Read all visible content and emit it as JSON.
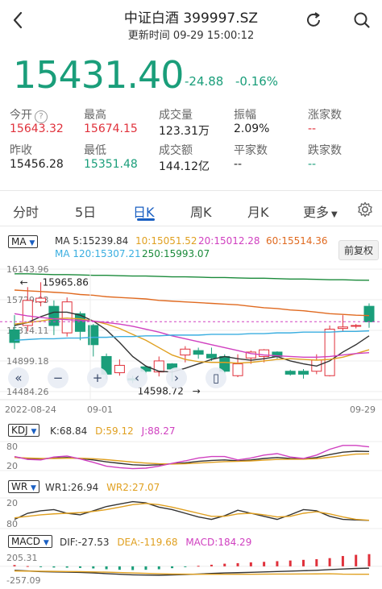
{
  "header": {
    "title": "中证白酒 399997.SZ",
    "update_label": "更新时间",
    "update_time": "09-29 15:00:12"
  },
  "quote": {
    "price": "15431.40",
    "change": "-24.88",
    "change_pct": "-0.16%"
  },
  "stats": [
    {
      "label": "今开",
      "value": "15643.32",
      "color": "red",
      "info_icon": true
    },
    {
      "label": "最高",
      "value": "15674.15",
      "color": "red"
    },
    {
      "label": "成交量",
      "value": "123.31万",
      "color": "normal"
    },
    {
      "label": "振幅",
      "value": "2.09%",
      "color": "normal"
    },
    {
      "label": "涨家数",
      "value": "--",
      "color": "red"
    },
    {
      "label": "昨收",
      "value": "15456.28",
      "color": "normal"
    },
    {
      "label": "最低",
      "value": "15351.48",
      "color": "green"
    },
    {
      "label": "成交额",
      "value": "144.12亿",
      "color": "normal"
    },
    {
      "label": "平家数",
      "value": "--",
      "color": "normal"
    },
    {
      "label": "跌家数",
      "value": "--",
      "color": "green"
    }
  ],
  "tabs": [
    "分时",
    "5日",
    "日K",
    "周K",
    "月K",
    "更多"
  ],
  "active_tab": "日K",
  "ma_legend": {
    "selector": "MA",
    "items": [
      {
        "text": "MA 5:15239.84",
        "color": "#333333"
      },
      {
        "text": "10:15051.52",
        "color": "#e0a020"
      },
      {
        "text": "20:15012.28",
        "color": "#d040c0"
      },
      {
        "text": "60:15514.36",
        "color": "#e06a20"
      },
      {
        "text": "MA 120:15307.21",
        "color": "#3aaee0"
      },
      {
        "text": "250:15993.07",
        "color": "#1a8a3a"
      }
    ],
    "fuquan_button": "前复权"
  },
  "main_axis": {
    "y_labels": [
      "16143.96",
      "15729.03",
      "15314.11",
      "14899.18",
      "14484.26"
    ],
    "x_labels": [
      "2022-08-24",
      "09-01",
      "09-29"
    ]
  },
  "main_annotations": {
    "high": "15965.86",
    "low": "14598.72"
  },
  "kdj": {
    "selector": "KDJ",
    "k": "K:68.84",
    "d": "D:59.12",
    "j": "J:88.27",
    "y_labels": [
      "80",
      "20"
    ]
  },
  "wr": {
    "selector": "WR",
    "wr1": "WR1:26.94",
    "wr2": "WR2:27.07",
    "y_labels": [
      "20",
      "80"
    ]
  },
  "macd": {
    "selector": "MACD",
    "dif": "DIF:-27.53",
    "dea": "DEA:-119.68",
    "macd": "MACD:184.29",
    "y_labels": [
      "205.31",
      "-257.09"
    ]
  },
  "colors": {
    "up": "#e0313b",
    "down": "#1a9e7a",
    "accent": "#1a5fc2"
  },
  "chart_data": {
    "type": "candlestick",
    "x": [
      "2022-08-24",
      "09-01",
      "09-29"
    ],
    "ylim": [
      14484.26,
      16143.96
    ],
    "candles": [
      {
        "o": 15320,
        "c": 15150,
        "h": 15520,
        "l": 15060
      },
      {
        "o": 15380,
        "c": 15720,
        "h": 15900,
        "l": 15300
      },
      {
        "o": 15700,
        "c": 15750,
        "h": 15966,
        "l": 15640
      },
      {
        "o": 15640,
        "c": 15380,
        "h": 15720,
        "l": 15250
      },
      {
        "o": 15280,
        "c": 15700,
        "h": 15760,
        "l": 15230
      },
      {
        "o": 15540,
        "c": 15300,
        "h": 15570,
        "l": 15180
      },
      {
        "o": 15380,
        "c": 15120,
        "h": 15400,
        "l": 14960
      },
      {
        "o": 14960,
        "c": 14720,
        "h": 15000,
        "l": 14650
      },
      {
        "o": 14740,
        "c": 14840,
        "h": 14920,
        "l": 14700
      },
      {
        "o": 14660,
        "c": 14640,
        "h": 14700,
        "l": 14599
      },
      {
        "o": 14820,
        "c": 14760,
        "h": 14840,
        "l": 14720
      },
      {
        "o": 14750,
        "c": 14900,
        "h": 14960,
        "l": 14690
      },
      {
        "o": 14860,
        "c": 14790,
        "h": 14870,
        "l": 14620
      },
      {
        "o": 14980,
        "c": 15060,
        "h": 15100,
        "l": 14880
      },
      {
        "o": 15040,
        "c": 14990,
        "h": 15080,
        "l": 14930
      },
      {
        "o": 14990,
        "c": 14940,
        "h": 15080,
        "l": 14900
      },
      {
        "o": 14960,
        "c": 14760,
        "h": 14990,
        "l": 14730
      },
      {
        "o": 14700,
        "c": 14860,
        "h": 14990,
        "l": 14680
      },
      {
        "o": 14940,
        "c": 15020,
        "h": 15040,
        "l": 14860
      },
      {
        "o": 14960,
        "c": 15050,
        "h": 15060,
        "l": 14880
      },
      {
        "o": 15020,
        "c": 14960,
        "h": 15030,
        "l": 14930
      },
      {
        "o": 14760,
        "c": 14720,
        "h": 14780,
        "l": 14700
      },
      {
        "o": 14760,
        "c": 14720,
        "h": 14790,
        "l": 14660
      },
      {
        "o": 14760,
        "c": 14910,
        "h": 14990,
        "l": 14720
      },
      {
        "o": 14700,
        "c": 15330,
        "h": 15380,
        "l": 14690
      },
      {
        "o": 15340,
        "c": 15360,
        "h": 15520,
        "l": 15300
      },
      {
        "o": 15380,
        "c": 15380,
        "h": 15400,
        "l": 15340
      },
      {
        "o": 15640,
        "c": 15430,
        "h": 15680,
        "l": 15350
      }
    ],
    "ma_lines": [
      {
        "name": "MA 5",
        "color": "#333333",
        "values": [
          15380,
          15420,
          15500,
          15560,
          15560,
          15520,
          15440,
          15320,
          15150,
          14960,
          14830,
          14760,
          14750,
          14800,
          14860,
          14920,
          14960,
          14930,
          14910,
          14930,
          14960,
          14900,
          14860,
          14830,
          14900,
          15020,
          15120,
          15239.84
        ]
      },
      {
        "name": "10",
        "color": "#e0a020",
        "values": [
          15400,
          15420,
          15440,
          15470,
          15480,
          15470,
          15440,
          15400,
          15340,
          15260,
          15180,
          15080,
          14980,
          14920,
          14890,
          14880,
          14880,
          14870,
          14880,
          14900,
          14920,
          14930,
          14920,
          14910,
          14920,
          14950,
          15000,
          15051.52
        ]
      },
      {
        "name": "20",
        "color": "#d040c0",
        "values": [
          15540,
          15510,
          15490,
          15470,
          15460,
          15450,
          15440,
          15420,
          15400,
          15370,
          15330,
          15290,
          15240,
          15200,
          15160,
          15120,
          15080,
          15040,
          15000,
          14980,
          14970,
          14960,
          14950,
          14950,
          14960,
          14980,
          15000,
          15012.28
        ]
      },
      {
        "name": "60",
        "color": "#e06a20",
        "values": [
          15860,
          15850,
          15840,
          15830,
          15820,
          15800,
          15790,
          15770,
          15760,
          15750,
          15740,
          15720,
          15710,
          15700,
          15690,
          15680,
          15670,
          15660,
          15640,
          15620,
          15610,
          15590,
          15580,
          15560,
          15540,
          15530,
          15520,
          15514.36
        ]
      },
      {
        "name": "MA 120",
        "color": "#3aaee0",
        "values": [
          15180,
          15190,
          15200,
          15200,
          15210,
          15210,
          15220,
          15220,
          15230,
          15230,
          15240,
          15240,
          15250,
          15250,
          15250,
          15260,
          15260,
          15260,
          15270,
          15270,
          15280,
          15280,
          15290,
          15290,
          15290,
          15300,
          15300,
          15307.21
        ]
      },
      {
        "name": "250",
        "color": "#1a8a3a",
        "values": [
          16080,
          16080,
          16075,
          16070,
          16070,
          16065,
          16060,
          16060,
          16055,
          16050,
          16050,
          16045,
          16040,
          16040,
          16035,
          16030,
          16030,
          16025,
          16020,
          16020,
          16015,
          16010,
          16010,
          16005,
          16000,
          16000,
          15995,
          15993.07
        ]
      }
    ],
    "kdj": {
      "ylim": [
        0,
        100
      ],
      "K": [
        45,
        40,
        38,
        42,
        44,
        40,
        34,
        26,
        20,
        14,
        12,
        14,
        18,
        22,
        28,
        32,
        34,
        30,
        34,
        40,
        44,
        40,
        38,
        44,
        56,
        66,
        70,
        68.84
      ],
      "D": [
        44,
        42,
        40,
        40,
        41,
        41,
        39,
        35,
        30,
        25,
        21,
        18,
        17,
        18,
        21,
        24,
        27,
        28,
        30,
        33,
        36,
        37,
        37,
        39,
        45,
        52,
        58,
        59.12
      ],
      "J": [
        48,
        36,
        34,
        46,
        50,
        38,
        24,
        8,
        2,
        -2,
        0,
        8,
        20,
        30,
        42,
        48,
        48,
        34,
        42,
        54,
        60,
        46,
        40,
        54,
        78,
        94,
        94,
        88.27
      ]
    },
    "wr": {
      "ylim": [
        0,
        100
      ],
      "WR1": [
        30,
        50,
        58,
        62,
        50,
        45,
        58,
        72,
        80,
        88,
        84,
        70,
        62,
        50,
        38,
        30,
        42,
        60,
        50,
        40,
        30,
        45,
        62,
        58,
        40,
        30,
        28,
        26.94
      ],
      "WR2": [
        35,
        40,
        45,
        48,
        50,
        52,
        56,
        62,
        70,
        78,
        82,
        78,
        70,
        60,
        50,
        40,
        40,
        48,
        50,
        45,
        38,
        40,
        50,
        55,
        48,
        38,
        30,
        27.07
      ]
    },
    "macd": {
      "ylim": [
        -257.09,
        205.31
      ],
      "DIF": [
        -60,
        -70,
        -80,
        -85,
        -88,
        -92,
        -100,
        -110,
        -120,
        -128,
        -132,
        -134,
        -130,
        -124,
        -116,
        -108,
        -100,
        -96,
        -90,
        -84,
        -78,
        -72,
        -66,
        -60,
        -50,
        -40,
        -32,
        -27.53
      ],
      "DEA": [
        -70,
        -72,
        -74,
        -76,
        -78,
        -80,
        -84,
        -88,
        -94,
        -100,
        -106,
        -112,
        -116,
        -118,
        -120,
        -120,
        -120,
        -120,
        -120,
        -118,
        -117,
        -116,
        -115,
        -114,
        -112,
        -118,
        -119,
        -119.68
      ],
      "MACD": [
        20,
        4,
        -12,
        -18,
        -20,
        -24,
        -32,
        -44,
        -52,
        -56,
        -52,
        -44,
        -28,
        -12,
        8,
        24,
        40,
        48,
        60,
        68,
        78,
        88,
        98,
        108,
        124,
        156,
        174,
        184.29
      ]
    }
  }
}
